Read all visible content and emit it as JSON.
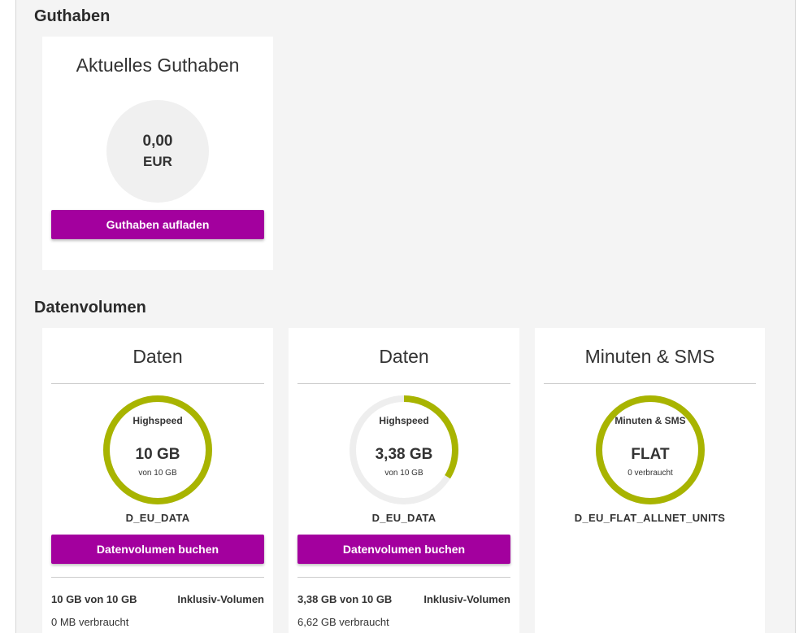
{
  "colors": {
    "accent": "#a3009e",
    "ring": "#a8b400",
    "ring_track": "#eeeeee"
  },
  "guthaben": {
    "section_title": "Guthaben",
    "card_title": "Aktuelles Guthaben",
    "amount": "0,00",
    "currency": "EUR",
    "button_label": "Guthaben aufladen"
  },
  "datenvolumen": {
    "section_title": "Datenvolumen",
    "cards": [
      {
        "title": "Daten",
        "ring_label": "Highspeed",
        "ring_value": "10 GB",
        "ring_sub": "von  10 GB",
        "remaining_fraction": 1.0,
        "plan_name": "D_EU_DATA",
        "button_label": "Datenvolumen buchen",
        "detail_amount": "10 GB von 10 GB",
        "detail_type": "Inklusiv-Volumen",
        "detail_used": "0 MB verbraucht"
      },
      {
        "title": "Daten",
        "ring_label": "Highspeed",
        "ring_value": "3,38 GB",
        "ring_sub": "von  10 GB",
        "remaining_fraction": 0.338,
        "plan_name": "D_EU_DATA",
        "button_label": "Datenvolumen buchen",
        "detail_amount": "3,38 GB von 10 GB",
        "detail_type": "Inklusiv-Volumen",
        "detail_used": "6,62 GB verbraucht"
      },
      {
        "title": "Minuten & SMS",
        "ring_label": "Minuten & SMS",
        "ring_value": "FLAT",
        "ring_sub": "0  verbraucht",
        "remaining_fraction": 1.0,
        "plan_name": "D_EU_FLAT_ALLNET_UNITS"
      }
    ]
  }
}
